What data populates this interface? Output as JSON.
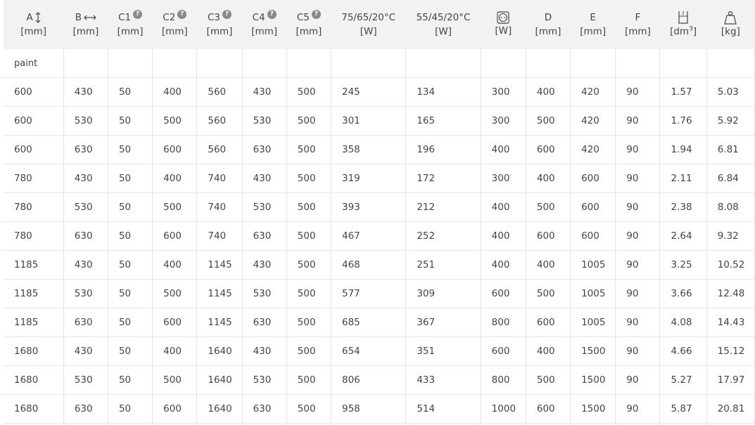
{
  "table": {
    "headers": [
      {
        "label": "A",
        "unit": "[mm]",
        "icon": "vertical-double-arrow-icon"
      },
      {
        "label": "B",
        "unit": "[mm]",
        "icon": "horizontal-double-arrow-icon"
      },
      {
        "label": "C1",
        "unit": "[mm]",
        "help": "?"
      },
      {
        "label": "C2",
        "unit": "[mm]",
        "help": "?"
      },
      {
        "label": "C3",
        "unit": "[mm]",
        "help": "?"
      },
      {
        "label": "C4",
        "unit": "[mm]",
        "help": "?"
      },
      {
        "label": "C5",
        "unit": "[mm]",
        "help": "?"
      },
      {
        "label": "75/65/20°C",
        "unit": "[W]"
      },
      {
        "label": "55/45/20°C",
        "unit": "[W]"
      },
      {
        "label": "",
        "unit": "[W]",
        "icon": "electric-socket-icon"
      },
      {
        "label": "D",
        "unit": "[mm]"
      },
      {
        "label": "E",
        "unit": "[mm]"
      },
      {
        "label": "F",
        "unit": "[mm]"
      },
      {
        "label": "",
        "unit": "[dm",
        "unit_sup": "3",
        "unit_end": "]",
        "icon": "water-volume-icon"
      },
      {
        "label": "",
        "unit": "[kg]",
        "icon": "weight-icon"
      }
    ],
    "group_label": "paint",
    "rows": [
      [
        "600",
        "430",
        "50",
        "400",
        "560",
        "430",
        "500",
        "245",
        "134",
        "300",
        "400",
        "420",
        "90",
        "1.57",
        "5.03"
      ],
      [
        "600",
        "530",
        "50",
        "500",
        "560",
        "530",
        "500",
        "301",
        "165",
        "300",
        "500",
        "420",
        "90",
        "1.76",
        "5.92"
      ],
      [
        "600",
        "630",
        "50",
        "600",
        "560",
        "630",
        "500",
        "358",
        "196",
        "400",
        "600",
        "420",
        "90",
        "1.94",
        "6.81"
      ],
      [
        "780",
        "430",
        "50",
        "400",
        "740",
        "430",
        "500",
        "319",
        "172",
        "300",
        "400",
        "600",
        "90",
        "2.11",
        "6.84"
      ],
      [
        "780",
        "530",
        "50",
        "500",
        "740",
        "530",
        "500",
        "393",
        "212",
        "400",
        "500",
        "600",
        "90",
        "2.38",
        "8.08"
      ],
      [
        "780",
        "630",
        "50",
        "600",
        "740",
        "630",
        "500",
        "467",
        "252",
        "400",
        "600",
        "600",
        "90",
        "2.64",
        "9.32"
      ],
      [
        "1185",
        "430",
        "50",
        "400",
        "1145",
        "430",
        "500",
        "468",
        "251",
        "400",
        "400",
        "1005",
        "90",
        "3.25",
        "10.52"
      ],
      [
        "1185",
        "530",
        "50",
        "500",
        "1145",
        "530",
        "500",
        "577",
        "309",
        "600",
        "500",
        "1005",
        "90",
        "3.66",
        "12.48"
      ],
      [
        "1185",
        "630",
        "50",
        "600",
        "1145",
        "630",
        "500",
        "685",
        "367",
        "800",
        "600",
        "1005",
        "90",
        "4.08",
        "14.43"
      ],
      [
        "1680",
        "430",
        "50",
        "400",
        "1640",
        "430",
        "500",
        "654",
        "351",
        "600",
        "400",
        "1500",
        "90",
        "4.66",
        "15.12"
      ],
      [
        "1680",
        "530",
        "50",
        "500",
        "1640",
        "530",
        "500",
        "806",
        "433",
        "800",
        "500",
        "1500",
        "90",
        "5.27",
        "17.97"
      ],
      [
        "1680",
        "630",
        "50",
        "600",
        "1640",
        "630",
        "500",
        "958",
        "514",
        "1000",
        "600",
        "1500",
        "90",
        "5.87",
        "20.81"
      ]
    ]
  }
}
